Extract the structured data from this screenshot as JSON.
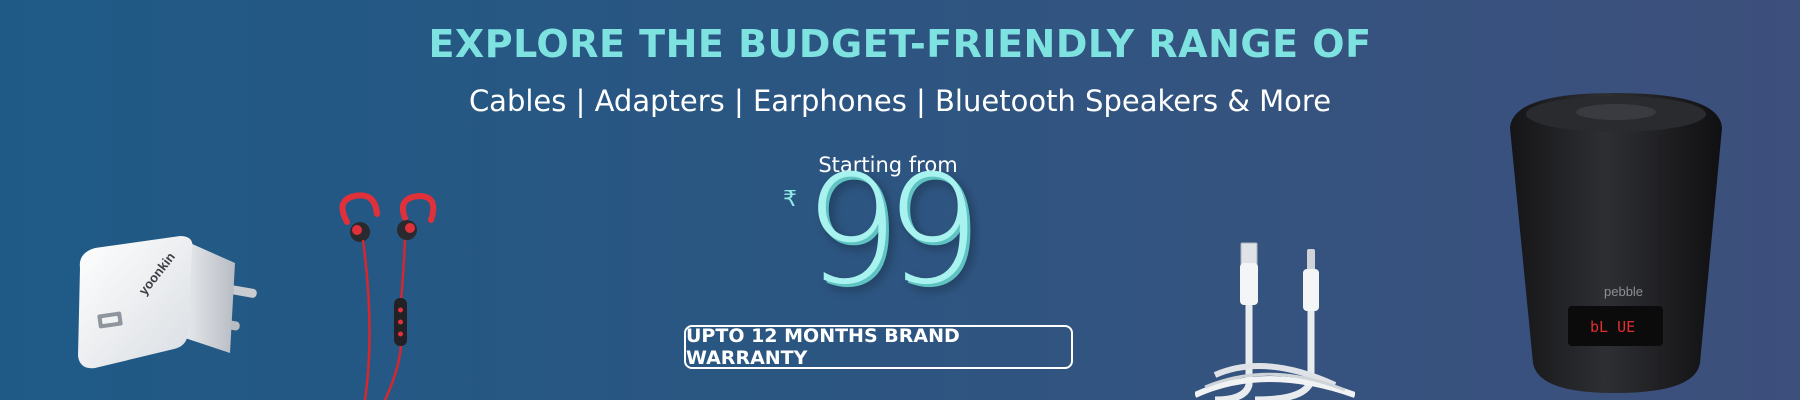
{
  "banner": {
    "headline": "EXPLORE THE BUDGET-FRIENDLY RANGE OF",
    "categories": "Cables | Adapters | Earphones | Bluetooth Speakers & More",
    "starting_label": "Starting from",
    "currency_symbol": "₹",
    "price": "99",
    "warranty_label": "UPTO 12 MONTHS BRAND WARRANTY"
  },
  "products": {
    "adapter_brand": "yoonkin",
    "speaker_brand": "pebble",
    "speaker_display": "bL UE"
  },
  "colors": {
    "headline": "#7ee3e0",
    "price": "#a8f3ef",
    "background_start": "#1f5a86",
    "background_end": "#3d4f7c"
  }
}
